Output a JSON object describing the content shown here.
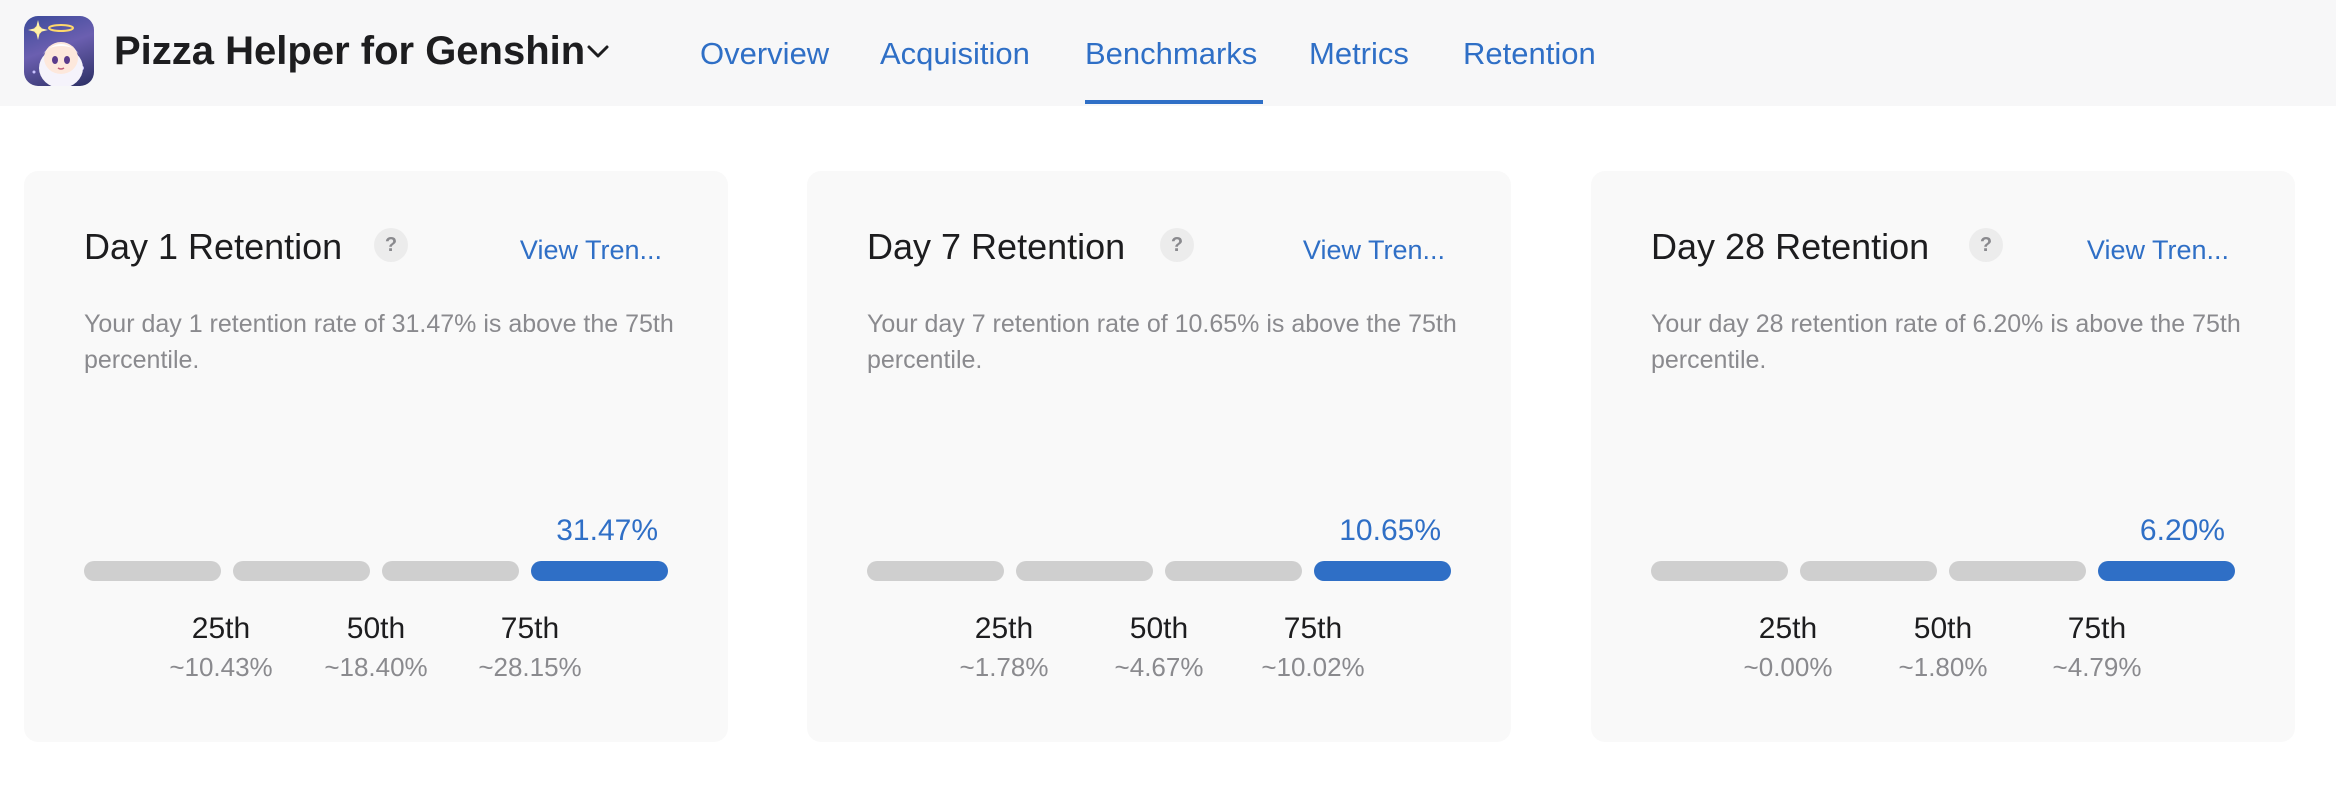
{
  "header": {
    "app_name": "Pizza Helper for Genshin",
    "tabs": [
      {
        "label": "Overview",
        "active": false
      },
      {
        "label": "Acquisition",
        "active": false
      },
      {
        "label": "Benchmarks",
        "active": true
      },
      {
        "label": "Metrics",
        "active": false
      },
      {
        "label": "Retention",
        "active": false
      }
    ]
  },
  "colors": {
    "accent": "#2f6fc6",
    "bar_inactive": "#cfcfcf",
    "card_bg": "#f9f9f9",
    "muted_text": "#8a8a8e"
  },
  "cards": [
    {
      "title": "Day 1 Retention",
      "help": "?",
      "link": "View Tren...",
      "description": "Your day 1 retention rate of 31.47% is above the 75th percentile.",
      "value": "31.47%",
      "active_segment": 4,
      "percentiles": [
        {
          "label": "25th",
          "value": "~10.43%"
        },
        {
          "label": "50th",
          "value": "~18.40%"
        },
        {
          "label": "75th",
          "value": "~28.15%"
        }
      ]
    },
    {
      "title": "Day 7 Retention",
      "help": "?",
      "link": "View Tren...",
      "description": "Your day 7 retention rate of 10.65% is above the 75th percentile.",
      "value": "10.65%",
      "active_segment": 4,
      "percentiles": [
        {
          "label": "25th",
          "value": "~1.78%"
        },
        {
          "label": "50th",
          "value": "~4.67%"
        },
        {
          "label": "75th",
          "value": "~10.02%"
        }
      ]
    },
    {
      "title": "Day 28 Retention",
      "help": "?",
      "link": "View Tren...",
      "description": "Your day 28 retention rate of 6.20% is above the 75th percentile.",
      "value": "6.20%",
      "active_segment": 4,
      "percentiles": [
        {
          "label": "25th",
          "value": "~0.00%"
        },
        {
          "label": "50th",
          "value": "~1.80%"
        },
        {
          "label": "75th",
          "value": "~4.79%"
        }
      ]
    }
  ]
}
